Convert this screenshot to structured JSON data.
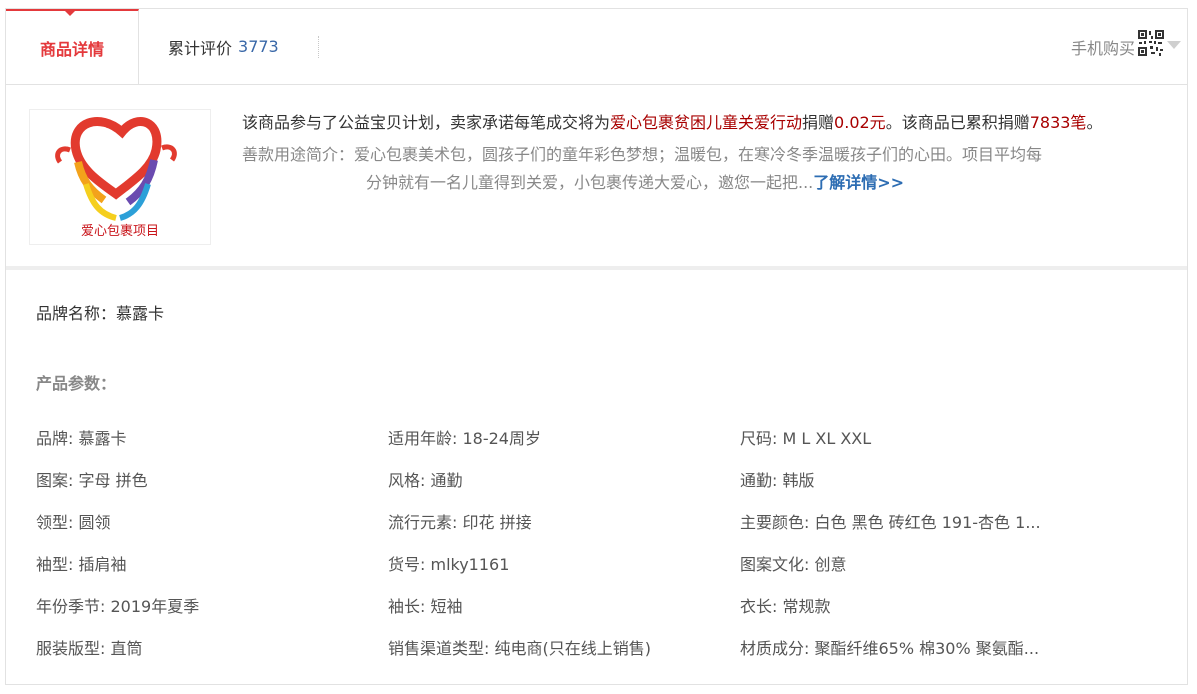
{
  "tabs": {
    "details": "商品详情",
    "reviews_label": "累计评价",
    "reviews_count": "3773",
    "mobile_buy": "手机购买"
  },
  "charity": {
    "logo_text": "爱心包裹项目",
    "intro_1": "该商品参与了公益宝贝计划，卖家承诺每笔成交将为",
    "project": "爱心包裹贫困儿童关爱行动",
    "intro_2": "捐赠",
    "amount": "0.02元",
    "intro_3": "。该商品已累积捐赠",
    "count": "7833笔",
    "intro_4": "。",
    "purpose_label": "善款用途简介：",
    "purpose_line1": "爱心包裹美术包，圆孩子们的童年彩色梦想；温暖包，在寒冷冬季温暖孩子们的心田。项目平均每",
    "purpose_line2": "分钟就有一名儿童得到关爱，小包裹传递大爱心，邀您一起把...",
    "more_link": "了解详情>>"
  },
  "params": {
    "brand_name": "品牌名称：慕露卡",
    "section_title": "产品参数：",
    "rows": [
      [
        "品牌: 慕露卡",
        "适用年龄: 18-24周岁",
        "尺码: M L XL XXL"
      ],
      [
        "图案: 字母 拼色",
        "风格: 通勤",
        "通勤: 韩版"
      ],
      [
        "领型: 圆领",
        "流行元素: 印花 拼接",
        "主要颜色: 白色 黑色 砖红色 191-杏色 1..."
      ],
      [
        "袖型: 插肩袖",
        "货号: mlky1161",
        "图案文化: 创意"
      ],
      [
        "年份季节: 2019年夏季",
        "袖长: 短袖",
        "衣长: 常规款"
      ],
      [
        "服装版型: 直筒",
        "销售渠道类型: 纯电商(只在线上销售)",
        "材质成分: 聚酯纤维65% 棉30% 聚氨酯..."
      ]
    ]
  },
  "colors": {
    "accent": "#e4393c",
    "charity_highlight": "#a80000",
    "link": "#2d6db3"
  }
}
